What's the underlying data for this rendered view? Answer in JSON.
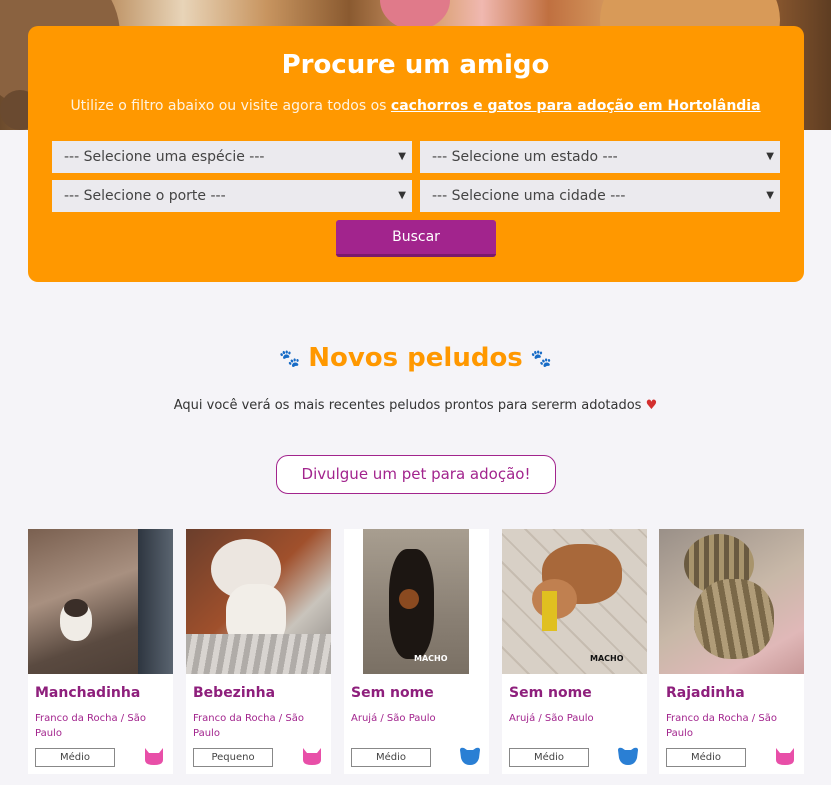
{
  "search": {
    "title": "Procure um amigo",
    "subtitle_prefix": "Utilize o filtro abaixo ou visite agora todos os",
    "subtitle_link": "cachorros e gatos para adoção em Hortolândia",
    "species_placeholder": "--- Selecione uma espécie ---",
    "state_placeholder": "--- Selecione um estado ---",
    "size_placeholder": "--- Selecione o porte ---",
    "city_placeholder": "--- Selecione uma cidade ---",
    "button_label": "Buscar"
  },
  "section": {
    "title": "Novos peludos",
    "subtitle": "Aqui você verá os mais recentes peludos prontos para sererm adotados",
    "cta_label": "Divulgue um pet para adoção!"
  },
  "pets": [
    {
      "name": "Manchadinha",
      "location": "Franco da Rocha / São Paulo",
      "size": "Médio",
      "species_icon": "cat-icon",
      "species_color": "#e84fa8"
    },
    {
      "name": "Bebezinha",
      "location": "Franco da Rocha / São Paulo",
      "size": "Pequeno",
      "species_icon": "cat-icon",
      "species_color": "#e84fa8"
    },
    {
      "name": "Sem nome",
      "location": "Arujá / São Paulo",
      "size": "Médio",
      "species_icon": "dog-icon",
      "species_color": "#2a7fd4",
      "photo_label": "MACHO"
    },
    {
      "name": "Sem nome",
      "location": "Arujá / São Paulo",
      "size": "Médio",
      "species_icon": "dog-icon",
      "species_color": "#2a7fd4",
      "photo_label": "MACHO"
    },
    {
      "name": "Rajadinha",
      "location": "Franco da Rocha / São Paulo",
      "size": "Médio",
      "species_icon": "cat-icon",
      "species_color": "#e84fa8"
    }
  ],
  "colors": {
    "orange": "#ff9800",
    "purple": "#a2248d"
  }
}
